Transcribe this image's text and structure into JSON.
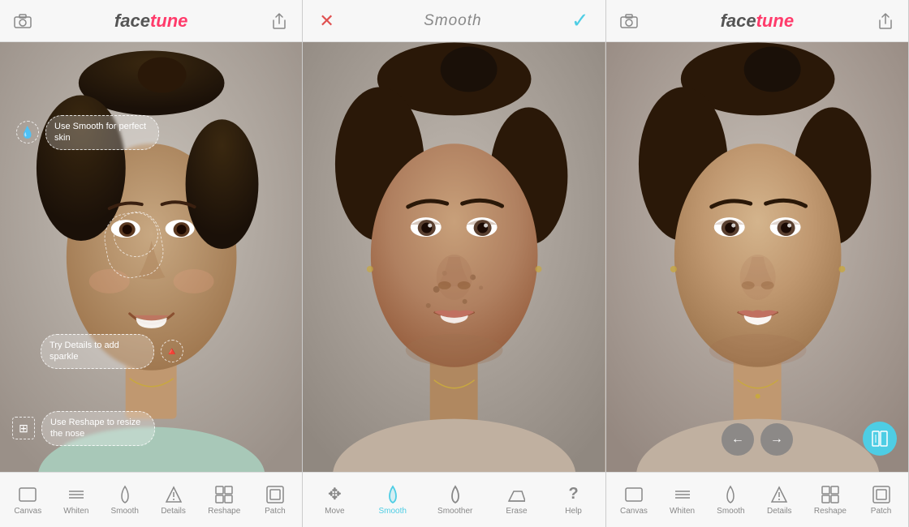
{
  "app": {
    "name": "facetune",
    "name_face": "face",
    "name_tune": "tune"
  },
  "panel1": {
    "header": {
      "camera_label": "📷",
      "share_label": "⬆"
    },
    "annotations": [
      {
        "id": "smooth-tip",
        "icon": "💧",
        "text": "Use Smooth for perfect skin"
      },
      {
        "id": "details-tip",
        "icon": "▲",
        "text": "Try Details to add sparkle"
      },
      {
        "id": "reshape-tip",
        "icon": "⊞",
        "text": "Use Reshape to resize the nose"
      }
    ],
    "toolbar": [
      {
        "id": "canvas",
        "icon": "▭",
        "label": "Canvas"
      },
      {
        "id": "whiten",
        "icon": "≡",
        "label": "Whiten"
      },
      {
        "id": "smooth",
        "icon": "💧",
        "label": "Smooth"
      },
      {
        "id": "details",
        "icon": "▲",
        "label": "Details"
      },
      {
        "id": "reshape",
        "icon": "⊞",
        "label": "Reshape"
      },
      {
        "id": "patch",
        "icon": "◫",
        "label": "Patch"
      }
    ]
  },
  "panel2": {
    "header": {
      "cancel_label": "✕",
      "title": "Smooth",
      "confirm_label": "✓"
    },
    "toolbar": [
      {
        "id": "move",
        "icon": "✥",
        "label": "Move"
      },
      {
        "id": "smooth",
        "icon": "💧",
        "label": "Smooth",
        "active": true
      },
      {
        "id": "smoother",
        "icon": "💧",
        "label": "Smoother"
      },
      {
        "id": "erase",
        "icon": "⬜",
        "label": "Erase"
      },
      {
        "id": "help",
        "icon": "?",
        "label": "Help"
      }
    ]
  },
  "panel3": {
    "header": {
      "camera_label": "📷",
      "share_label": "⬆"
    },
    "nav": {
      "back_label": "←",
      "forward_label": "→"
    },
    "compare_label": "⧉",
    "toolbar": [
      {
        "id": "canvas",
        "icon": "▭",
        "label": "Canvas"
      },
      {
        "id": "whiten",
        "icon": "≡",
        "label": "Whiten"
      },
      {
        "id": "smooth",
        "icon": "💧",
        "label": "Smooth"
      },
      {
        "id": "details",
        "icon": "▲",
        "label": "Details"
      },
      {
        "id": "reshape",
        "icon": "⊞",
        "label": "Reshape"
      },
      {
        "id": "patch",
        "icon": "◫",
        "label": "Patch"
      }
    ]
  },
  "colors": {
    "accent": "#4ecde4",
    "logo_pink": "#ff3b6b",
    "cancel_red": "#e05050",
    "toolbar_inactive": "#888888",
    "bg_panel": "#f0f0f0",
    "bg_header": "#f7f7f7"
  }
}
